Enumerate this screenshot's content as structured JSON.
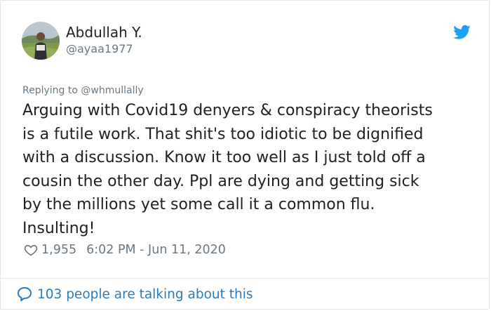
{
  "author": {
    "display_name": "Abdullah Y.",
    "handle": "@ayaa1977"
  },
  "reply": {
    "label": "Replying to @whmullally"
  },
  "tweet": {
    "lines": [
      "Arguing with Covid19 denyers & conspiracy theorists",
      "is a futile work. That shit's too idiotic to be dignified",
      "with a discussion. Know it too well as I just told off a",
      "cousin the other day. Ppl are dying and getting sick",
      "by the millions yet some call it a common flu.",
      "Insulting!"
    ]
  },
  "meta": {
    "likes": "1,955",
    "timestamp": "6:02 PM - Jun 11, 2020"
  },
  "footer": {
    "talking": "103 people are talking about this"
  },
  "icons": {
    "brand": "twitter-bird-icon",
    "like": "heart-icon",
    "conversation": "speech-bubble-icon"
  },
  "colors": {
    "brand_blue": "#1da1f2",
    "link_blue": "#2b7bb9",
    "muted": "#697882",
    "text": "#1c2022",
    "border": "#e1e8ed"
  }
}
